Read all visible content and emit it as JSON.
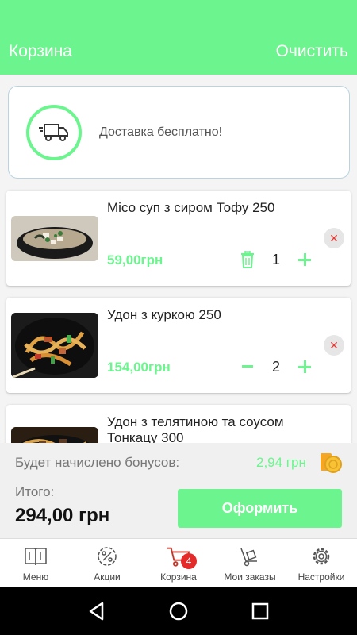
{
  "header": {
    "title": "Корзина",
    "clear_label": "Очистить"
  },
  "delivery": {
    "text": "Доставка бесплатно!",
    "icon": "truck-icon"
  },
  "cart_items": [
    {
      "name": "Місо суп з сиром Тофу 250",
      "price": "59,00грн",
      "quantity": "1",
      "decrement_icon": "trash-icon"
    },
    {
      "name": "Удон з куркою 250",
      "price": "154,00грн",
      "quantity": "2",
      "decrement_icon": "minus-icon"
    },
    {
      "name": "Удон з телятиною  та  соусом Тонкацу  300",
      "price": "",
      "quantity": "",
      "decrement_icon": ""
    }
  ],
  "summary": {
    "bonus_label": "Будет начислено бонусов:",
    "bonus_value": "2,94 грн",
    "total_label": "Итого:",
    "total_value": "294,00 грн",
    "checkout_label": "Оформить"
  },
  "bottom_nav": {
    "items": [
      {
        "label": "Меню",
        "icon": "menu-book-icon"
      },
      {
        "label": "Акции",
        "icon": "discount-gear-icon"
      },
      {
        "label": "Корзина",
        "icon": "cart-icon",
        "badge": "4"
      },
      {
        "label": "Мои заказы",
        "icon": "hand-truck-icon"
      },
      {
        "label": "Настройки",
        "icon": "gear-icon"
      }
    ]
  },
  "colors": {
    "accent": "#6cf58e",
    "badge": "#e52a2a",
    "remove": "#e53935"
  }
}
